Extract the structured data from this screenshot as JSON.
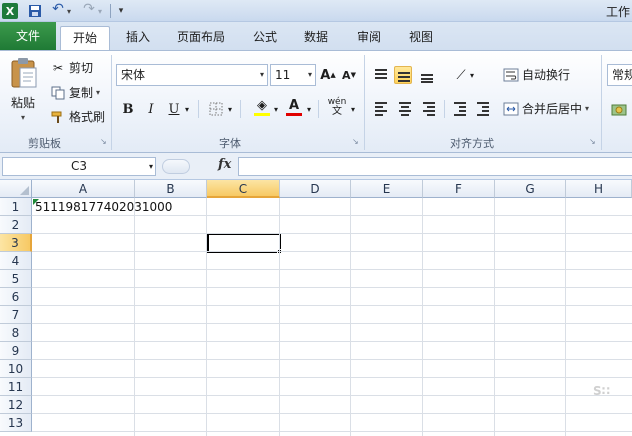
{
  "window": {
    "title": "工作"
  },
  "quick_access": {
    "icons": [
      "excel-logo",
      "save-icon",
      "undo-icon",
      "redo-icon"
    ]
  },
  "tabs": [
    {
      "label": "文件"
    },
    {
      "label": "开始"
    },
    {
      "label": "插入"
    },
    {
      "label": "页面布局"
    },
    {
      "label": "公式"
    },
    {
      "label": "数据"
    },
    {
      "label": "审阅"
    },
    {
      "label": "视图"
    }
  ],
  "ribbon": {
    "clipboard": {
      "paste": "粘贴",
      "cut": "剪切",
      "copy": "复制",
      "format_painter": "格式刷",
      "group": "剪贴板"
    },
    "font": {
      "name": "宋体",
      "size": "11",
      "group": "字体"
    },
    "alignment": {
      "wrap": "自动换行",
      "merge": "合并后居中",
      "group": "对齐方式"
    },
    "number": {
      "format": "常规"
    }
  },
  "formula_bar": {
    "name_box": "C3",
    "fx": "fx",
    "content": ""
  },
  "grid": {
    "columns": [
      "A",
      "B",
      "C",
      "D",
      "E",
      "F",
      "G",
      "H"
    ],
    "rows": [
      "1",
      "2",
      "3",
      "4",
      "5",
      "6",
      "7",
      "8",
      "9",
      "10",
      "11",
      "12",
      "13"
    ],
    "selected_column": "C",
    "selected_row": "3",
    "cells": {
      "A1": "511198177402031000"
    }
  },
  "colors": {
    "file_tab": "#1f7a35",
    "selection": "#f7c964",
    "ribbon_bg": "#eef3fa"
  }
}
